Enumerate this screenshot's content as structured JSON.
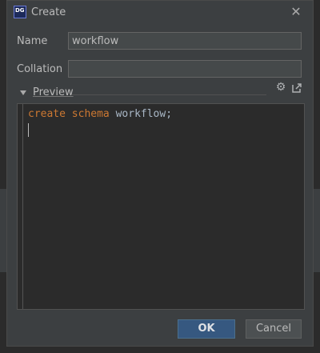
{
  "window": {
    "title": "Create",
    "app_icon_text": "DG"
  },
  "form": {
    "name_label": "Name",
    "name_value": "workflow",
    "collation_label": "Collation",
    "collation_value": ""
  },
  "preview": {
    "label": "Preview",
    "code": {
      "kw1": "create",
      "kw2": "schema",
      "identifier": "workflow;"
    }
  },
  "buttons": {
    "ok": "OK",
    "cancel": "Cancel"
  },
  "colors": {
    "keyword": "#cc7832",
    "identifier": "#a9b7c6",
    "ok_button": "#365880",
    "background": "#3c3f41"
  },
  "icons": [
    "datagrip-app-icon",
    "close-icon",
    "collapse-arrow-icon",
    "gear-icon",
    "external-link-icon"
  ]
}
